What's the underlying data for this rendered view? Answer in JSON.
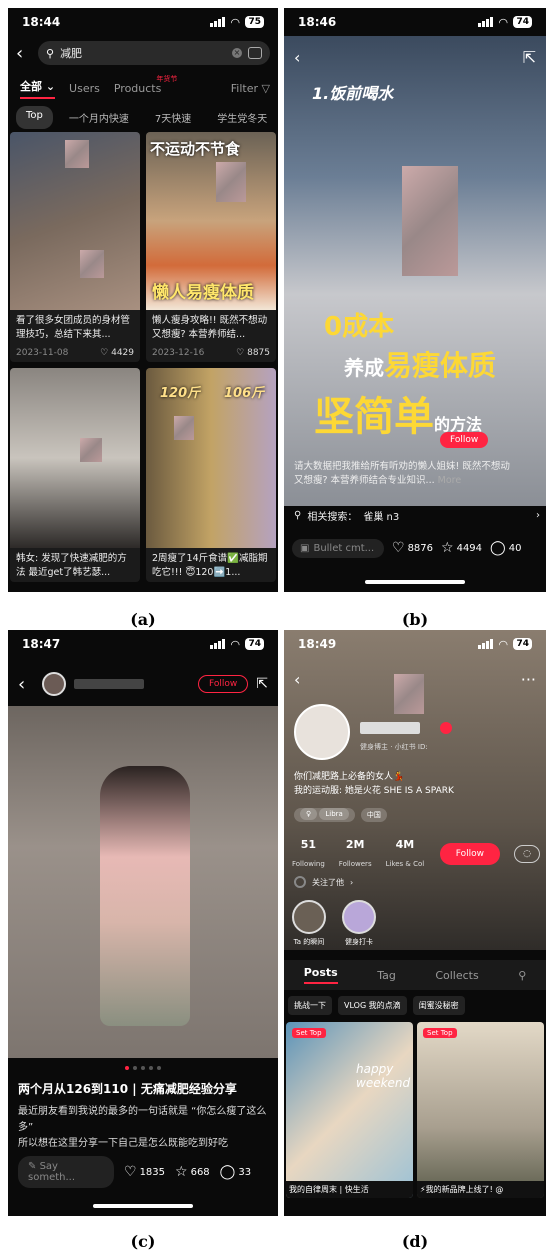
{
  "captions": [
    "(a)",
    "(b)",
    "(c)",
    "(d)"
  ],
  "screen_a": {
    "time": "18:44",
    "battery": "75",
    "search_query": "减肥",
    "filters": {
      "all": "全部",
      "users": "Users",
      "products": "Products",
      "products_badge": "年货节",
      "filter": "Filter"
    },
    "subtags": [
      "Top",
      "一个月内快速",
      "7天快速",
      "学生党冬天"
    ],
    "cards": [
      {
        "title": "看了很多女团成员的身材管理技巧，总结下来其...",
        "date": "2023-11-08",
        "likes": "4429"
      },
      {
        "title": "懒人瘦身攻略!! 既然不想动又想瘦? 本营养师结...",
        "date": "2023-12-16",
        "likes": "8875",
        "overlay_top": "不运动不节食",
        "overlay_bottom": "懒人易瘦体质"
      },
      {
        "title": "韩女: 发现了快速减肥的方法 最近get了韩艺瑟...",
        "likes": ""
      },
      {
        "title": "2周瘦了14斤食谱✅减脂期吃它!!! 😇120➡️1...",
        "overlay_left": "120斤",
        "overlay_right": "106斤"
      }
    ]
  },
  "screen_b": {
    "time": "18:46",
    "battery": "74",
    "step": "1.饭前喝水",
    "big1": "0成本",
    "big2_prefix": "养成",
    "big2_hl": "易瘦体质",
    "big3": "坚简单",
    "big3_suffix": "的方法",
    "follow": "Follow",
    "desc": "请大数据把我推给所有听劝的懒人姐妹! 既然不想动又想瘦? 本营养师结合专业知识...",
    "more": "More",
    "related_label": "相关搜索：",
    "related_value": "雀巢 n3",
    "comment_placeholder": "Bullet cmt...",
    "likes": "8876",
    "stars": "4494",
    "comments": "40"
  },
  "screen_c": {
    "time": "18:47",
    "battery": "74",
    "follow": "Follow",
    "title": "两个月从126到110 | 无痛减肥经验分享",
    "body_line1": "最近朋友看到我说的最多的一句话就是 “你怎么瘦了这么多”",
    "body_line2": "所以想在这里分享一下自己是怎么既能吃到好吃",
    "comment_placeholder": "Say someth...",
    "likes": "1835",
    "stars": "668",
    "comments": "33"
  },
  "screen_d": {
    "time": "18:49",
    "battery": "74",
    "subtitle": "健身博主 · 小红书 ID:",
    "bio_line1": "你们减肥路上必备的女人💃",
    "bio_line2": "我的运动服: 她是火花 SHE IS A SPARK",
    "tags": [
      "Libra",
      "中国"
    ],
    "stats": [
      {
        "value": "51",
        "label": "Following"
      },
      {
        "value": "2M",
        "label": "Followers"
      },
      {
        "value": "4M",
        "label": "Likes & Col"
      }
    ],
    "follow": "Follow",
    "mutual": "关注了他",
    "highlights": [
      "Ta 的瞬间",
      "健身打卡"
    ],
    "tabs": [
      "Posts",
      "Tag",
      "Collects"
    ],
    "collections": [
      "挑战一下",
      "VLOG 我的点滴",
      "闺蜜没秘密"
    ],
    "set_top": "Set Top",
    "card_titles": [
      "我的自律周末 | 快生活",
      "⚡我的新品牌上线了! @"
    ],
    "card_overlay": "happy weekend"
  }
}
